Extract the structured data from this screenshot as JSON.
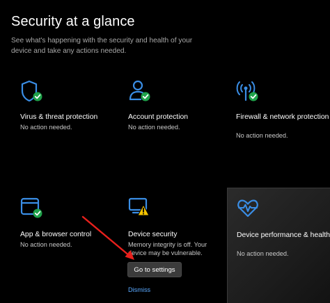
{
  "header": {
    "title": "Security at a glance",
    "subtitle": "See what's happening with the security and health of your device and take any actions needed."
  },
  "cards": [
    {
      "title": "Virus & threat protection",
      "status": "No action needed.",
      "icon": "shield-icon",
      "badge": "ok-check-icon"
    },
    {
      "title": "Account protection",
      "status": "No action needed.",
      "icon": "person-icon",
      "badge": "ok-check-icon"
    },
    {
      "title": "Firewall & network protection",
      "status": "No action needed.",
      "icon": "antenna-icon",
      "badge": "ok-check-icon"
    },
    {
      "title": "App & browser control",
      "status": "No action needed.",
      "icon": "browser-window-icon",
      "badge": "ok-check-icon"
    },
    {
      "title": "Device security",
      "status": "Memory integrity is off. Your device may be vulnerable.",
      "icon": "chip-icon",
      "badge": "warning-icon",
      "action_label": "Go to settings",
      "dismiss_label": "Dismiss"
    },
    {
      "title": "Device performance & health",
      "status": "No action needed.",
      "icon": "heartbeat-icon"
    }
  ],
  "colors": {
    "accent_blue": "#3a8ee6",
    "ok_green": "#1fa24a",
    "warning_yellow": "#f5c400",
    "link_blue": "#5aa9ff",
    "annotation_red": "#e8201c"
  }
}
